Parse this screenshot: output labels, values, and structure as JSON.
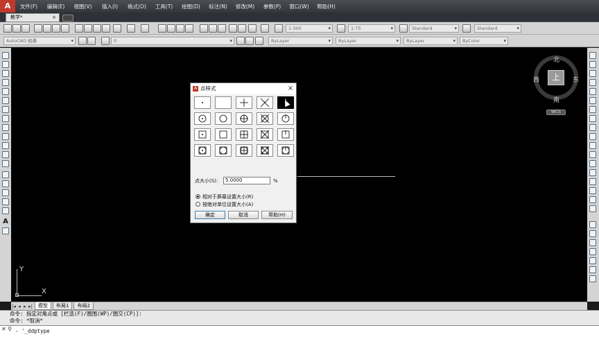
{
  "app": {
    "logo": "A"
  },
  "menu": [
    "文件(F)",
    "编辑(E)",
    "视图(V)",
    "插入(I)",
    "格式(O)",
    "工具(T)",
    "绘图(D)",
    "标注(N)",
    "修改(M)",
    "参数(P)",
    "窗口(W)",
    "帮助(H)"
  ],
  "doc_tab": {
    "label": "教学*",
    "close": "×"
  },
  "toolbar1": {
    "annoscale": "1:300",
    "dimscale": "1:75",
    "textstyle": "Standard",
    "dimstyle": "Standard"
  },
  "toolbar2": {
    "workspace": "AutoCAD 经典",
    "layer": "0",
    "color": "ByLayer",
    "linetype": "ByLayer",
    "lineweight": "ByLayer",
    "plotstyle": "ByColor"
  },
  "viewcube": {
    "north": "北",
    "south": "南",
    "west": "西",
    "east": "东",
    "face": "上",
    "wcs": "WCS"
  },
  "ucs": {
    "x": "X",
    "y": "Y"
  },
  "layout_tabs": [
    "模型",
    "布局1",
    "布局2"
  ],
  "command": {
    "history1": "命令: 指定对角点或 [栏选(F)/圈围(WP)/圈交(CP)]:",
    "history2": "命令: *取消*",
    "prompt": "- '_ddptype"
  },
  "dialog": {
    "title": "点样式",
    "close": "×",
    "size_label": "点大小(S):",
    "size_value": "5.0000",
    "size_unit": "%",
    "radio_relative": "相对于屏幕设置大小(R)",
    "radio_absolute": "按绝对单位设置大小(A)",
    "radio_selected": "relative",
    "ok": "确定",
    "cancel": "取消",
    "help": "帮助(H)",
    "selected_style_index": 4
  }
}
